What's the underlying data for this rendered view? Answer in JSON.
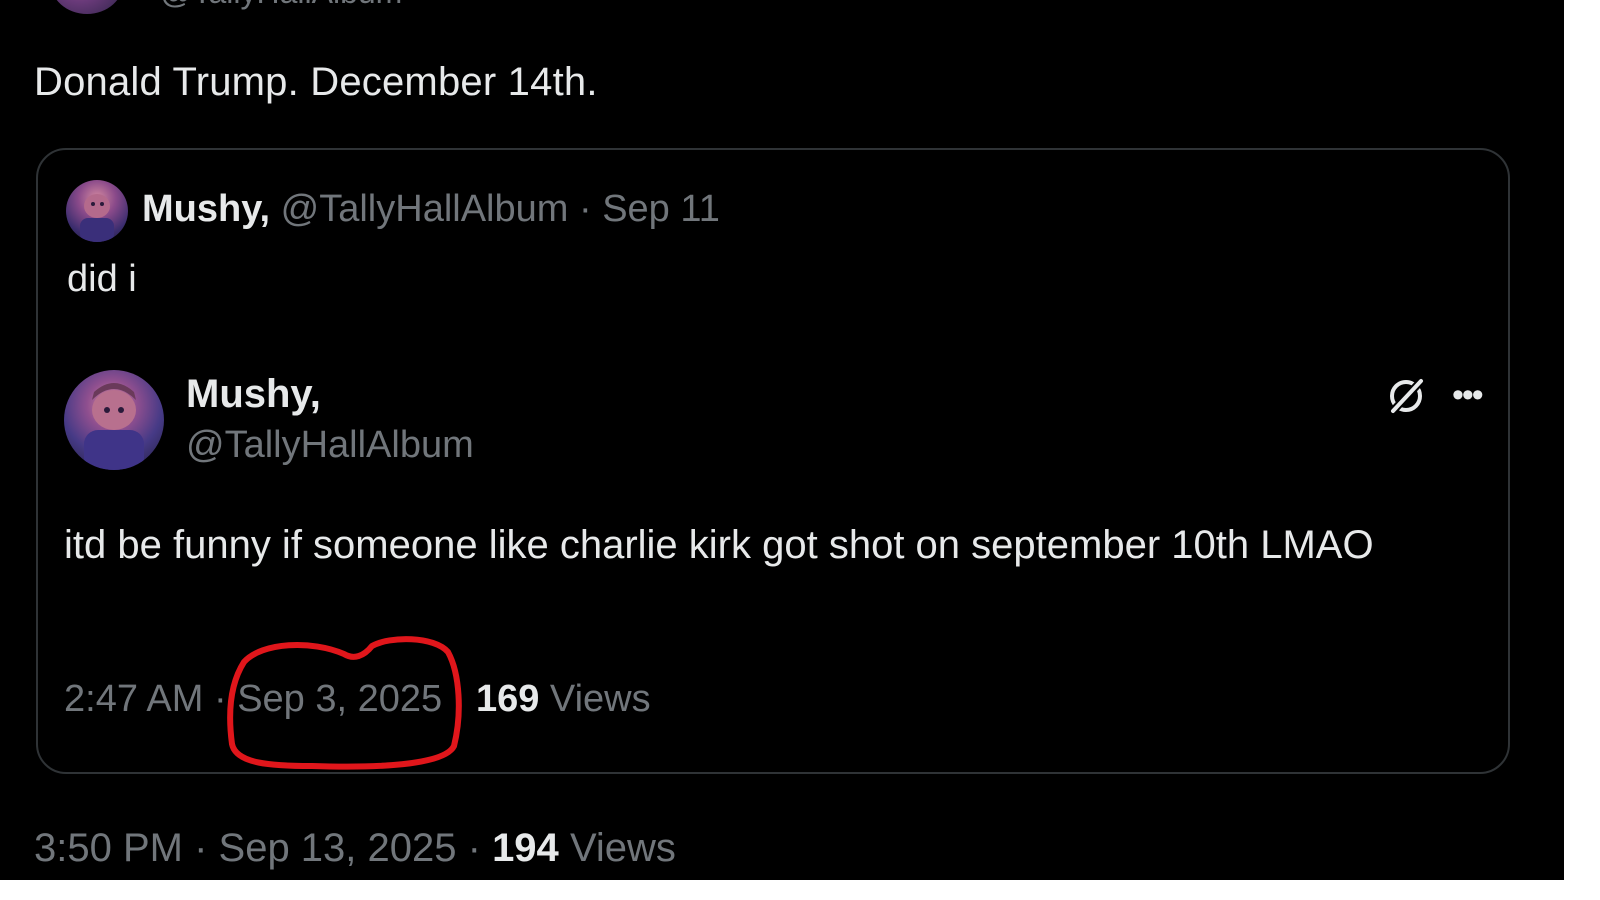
{
  "top_header": {
    "handle_partial": "@TallyHallAlbum"
  },
  "tweet": {
    "text": "Donald Trump. December 14th.",
    "time": "3:50 PM",
    "date": "Sep 13, 2025",
    "views_count": "194",
    "views_label": "Views",
    "separator": " · "
  },
  "quote": {
    "display_name": "Mushy,",
    "handle": "@TallyHallAlbum",
    "date": "Sep 11",
    "separator": " · ",
    "text": "did i"
  },
  "embedded_post": {
    "display_name": "Mushy,",
    "handle": "@TallyHallAlbum",
    "text": "itd be funny if someone like charlie kirk got shot on september 10th LMAO",
    "time": "2:47 AM",
    "date": "Sep 3, 2025",
    "views_count": "169",
    "views_label": "Views",
    "separator": " · ",
    "more_symbol": "•••"
  },
  "icons": {
    "grok": "grok-icon",
    "more": "more-icon"
  },
  "colors": {
    "background": "#000000",
    "text": "#e7e9ea",
    "muted": "#71767b",
    "border": "#2f3336",
    "annotation": "#e0161b"
  }
}
